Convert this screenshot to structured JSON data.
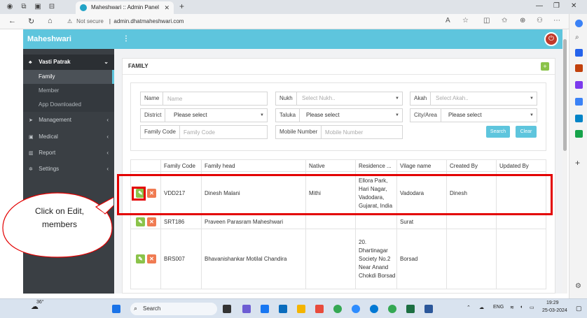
{
  "browser": {
    "tab_title": "Maheshwari :: Admin Panel",
    "security": "Not secure",
    "url": "admin.dhatmaheshwari.com"
  },
  "app": {
    "brand": "Maheshwari",
    "menu_icon": "⋮"
  },
  "sidebar": {
    "items": [
      {
        "label": "Vasti Patrak",
        "icon": "sitemap-icon"
      },
      {
        "label": "Family"
      },
      {
        "label": "Member"
      },
      {
        "label": "App Downloaded"
      },
      {
        "label": "Management",
        "icon": "send-icon"
      },
      {
        "label": "Medical",
        "icon": "medkit-icon"
      },
      {
        "label": "Report",
        "icon": "bar-chart-icon"
      },
      {
        "label": "Settings",
        "icon": "gear-icon"
      }
    ]
  },
  "panel": {
    "title": "FAMILY"
  },
  "filters": {
    "name": {
      "label": "Name",
      "placeholder": "Name"
    },
    "nukh": {
      "label": "Nukh",
      "placeholder": "Select Nukh.."
    },
    "akah": {
      "label": "Akah",
      "placeholder": "Select Akah.."
    },
    "district": {
      "label": "District",
      "value": "Please select"
    },
    "taluka": {
      "label": "Taluka",
      "value": "Please select"
    },
    "city": {
      "label": "City/Area",
      "value": "Please select"
    },
    "family_code": {
      "label": "Family Code",
      "placeholder": "Family Code"
    },
    "mobile": {
      "label": "Mobile Number",
      "placeholder": "Mobile Number"
    },
    "search_label": "Search",
    "clear_label": "Clear"
  },
  "table": {
    "headers": [
      "Family Code",
      "Family head",
      "Native",
      "Residence ...",
      "Vilage name",
      "Created By",
      "Updated By"
    ],
    "rows": [
      {
        "code": "VDD217",
        "head": "Dinesh Malani",
        "native": "Mithi",
        "residence": "Ellora Park, Hari Nagar, Vadodara, Gujarat, India",
        "village": "Vadodara",
        "created_by": "Dinesh",
        "updated_by": ""
      },
      {
        "code": "SRT186",
        "head": "Praveen Parasram Maheshwari",
        "native": "",
        "residence": "",
        "village": "Surat",
        "created_by": "",
        "updated_by": ""
      },
      {
        "code": "BRS007",
        "head": "Bhavanishankar Motilal Chandira",
        "native": "",
        "residence": "20. Dhartinagar Society No.2 Near Anand Chokdi Borsad",
        "village": "Borsad",
        "created_by": "",
        "updated_by": ""
      }
    ]
  },
  "callout": {
    "text": "Click on Edit, members"
  },
  "taskbar": {
    "search": "Search",
    "weather": "36°",
    "lang": "ENG",
    "time": "19:29",
    "date": "25-03-2024"
  }
}
